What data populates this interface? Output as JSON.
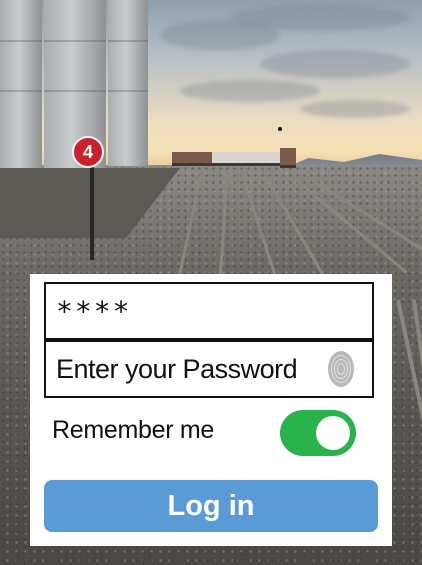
{
  "background": {
    "sign_number": "4"
  },
  "login": {
    "username_value": "****",
    "password_placeholder": "Enter your Password",
    "fingerprint_icon": "fingerprint-icon",
    "remember_label": "Remember me",
    "remember_enabled": true,
    "login_label": "Log in",
    "colors": {
      "toggle_on": "#29b34a",
      "login_button": "#5b9bd5"
    }
  }
}
